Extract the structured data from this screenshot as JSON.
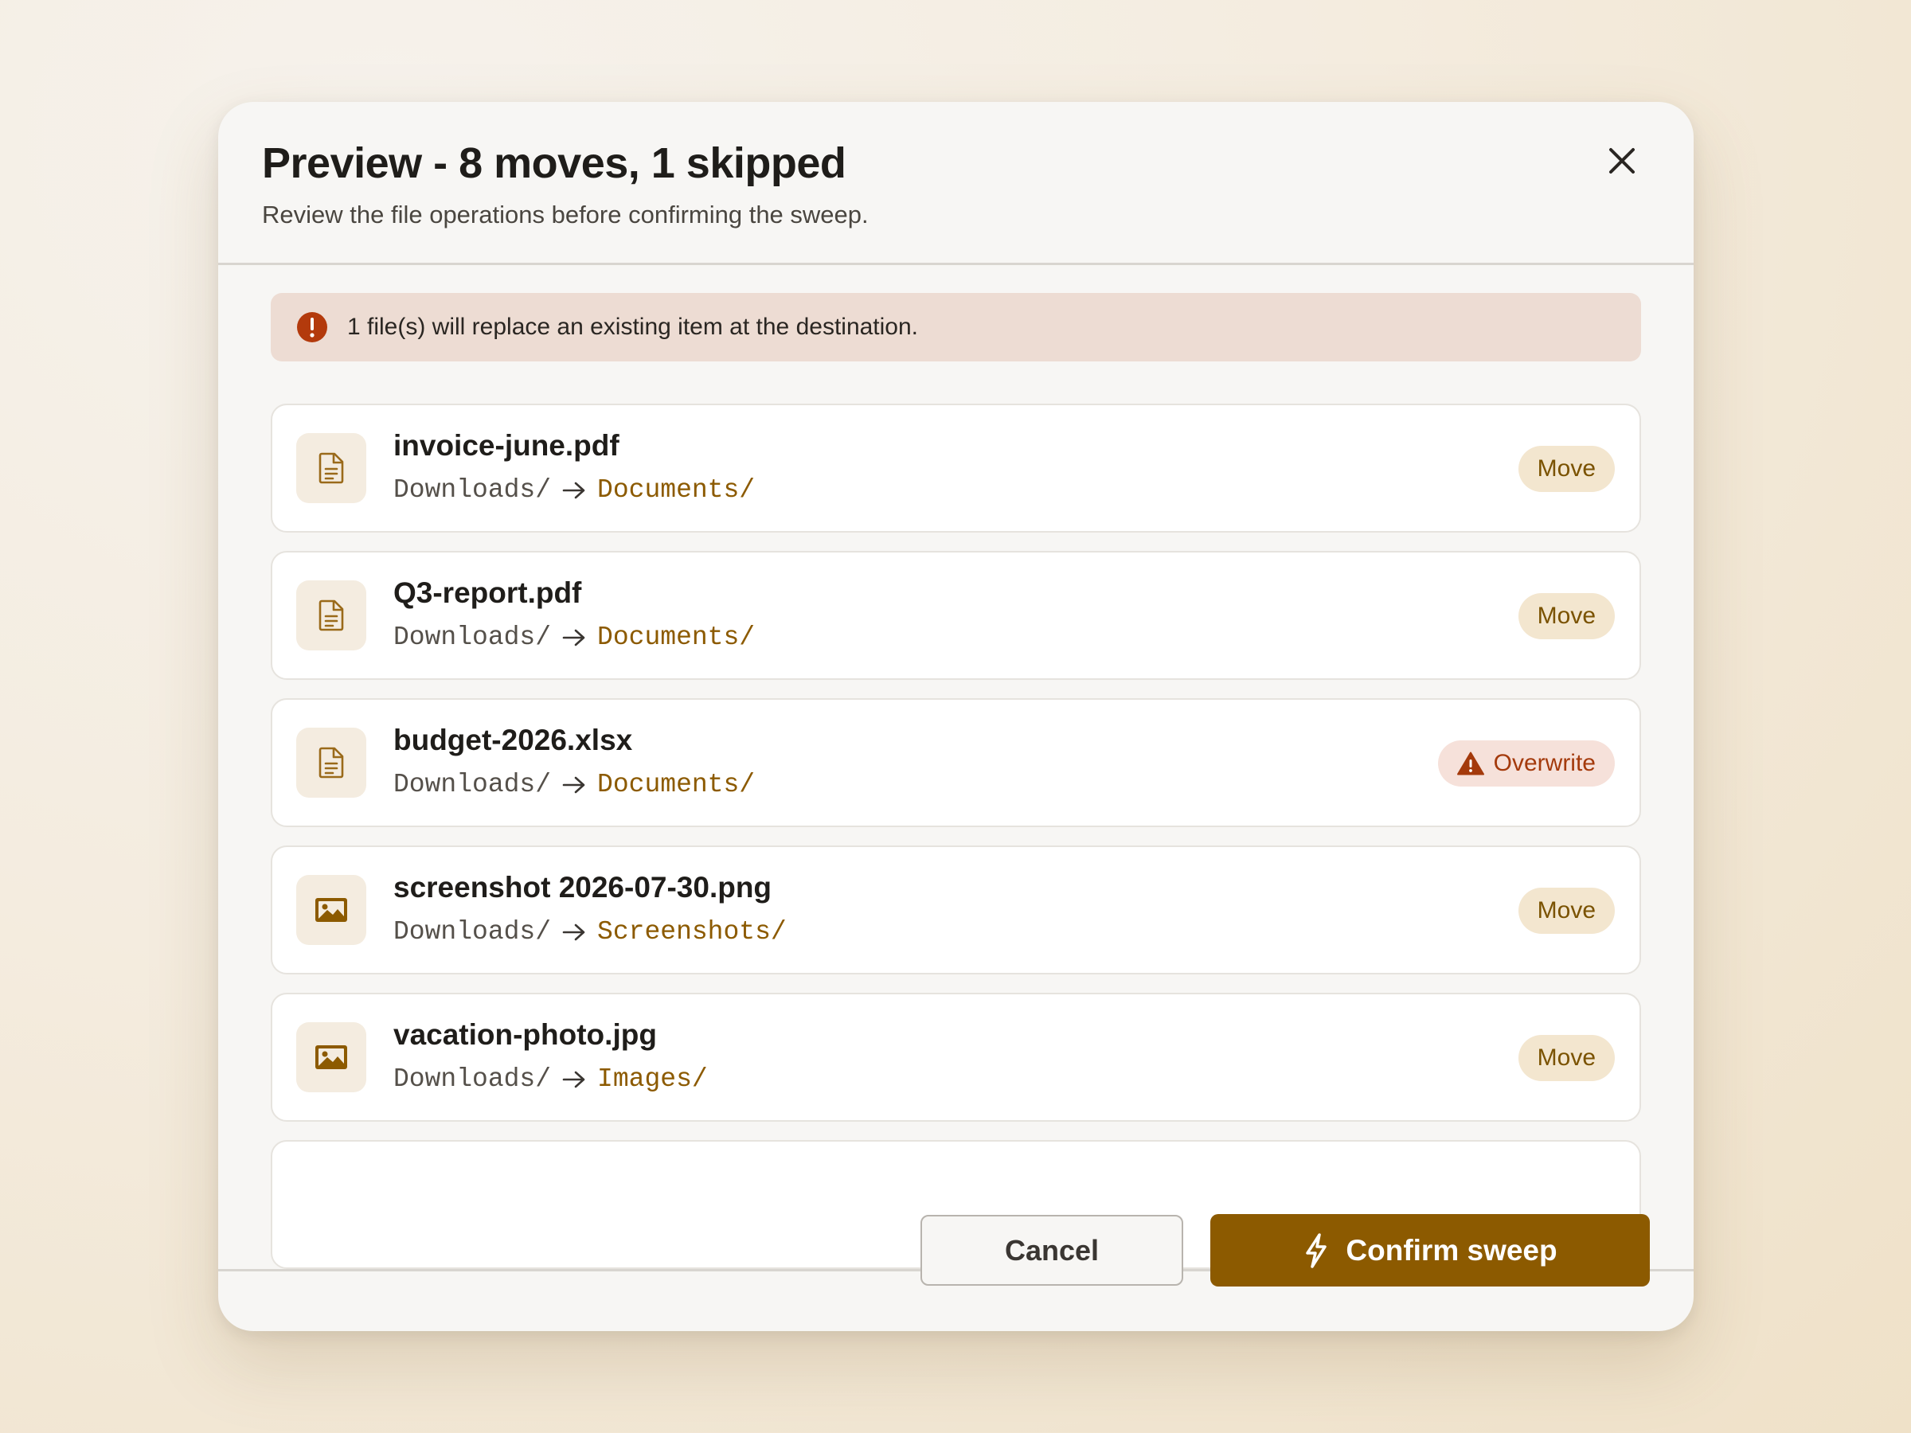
{
  "dialog": {
    "title": "Preview - 8 moves, 1 skipped",
    "subtitle": "Review the file operations before confirming the sweep.",
    "close_icon": "close-icon"
  },
  "alert": {
    "icon": "error-icon",
    "text": "1 file(s) will replace an existing item at the destination.",
    "color": "#b33a0c"
  },
  "files": [
    {
      "name": "invoice-june.pdf",
      "source": "Downloads/",
      "destination": "Documents/",
      "icon": "document-icon",
      "action": "Move"
    },
    {
      "name": "Q3-report.pdf",
      "source": "Downloads/",
      "destination": "Documents/",
      "icon": "document-icon",
      "action": "Move"
    },
    {
      "name": "budget-2026.xlsx",
      "source": "Downloads/",
      "destination": "Documents/",
      "icon": "document-icon",
      "action": "Overwrite"
    },
    {
      "name": "screenshot 2026-07-30.png",
      "source": "Downloads/",
      "destination": "Screenshots/",
      "icon": "image-icon",
      "action": "Move"
    },
    {
      "name": "vacation-photo.jpg",
      "source": "Downloads/",
      "destination": "Images/",
      "icon": "image-icon",
      "action": "Move"
    }
  ],
  "footer": {
    "cancel_label": "Cancel",
    "confirm_label": "Confirm sweep",
    "confirm_icon": "bolt-icon"
  },
  "colors": {
    "accent": "#8c5a00",
    "move_badge_bg": "#f3e6cf",
    "overwrite_badge_bg": "#f6e1da",
    "overwrite_text": "#a43a0c"
  }
}
